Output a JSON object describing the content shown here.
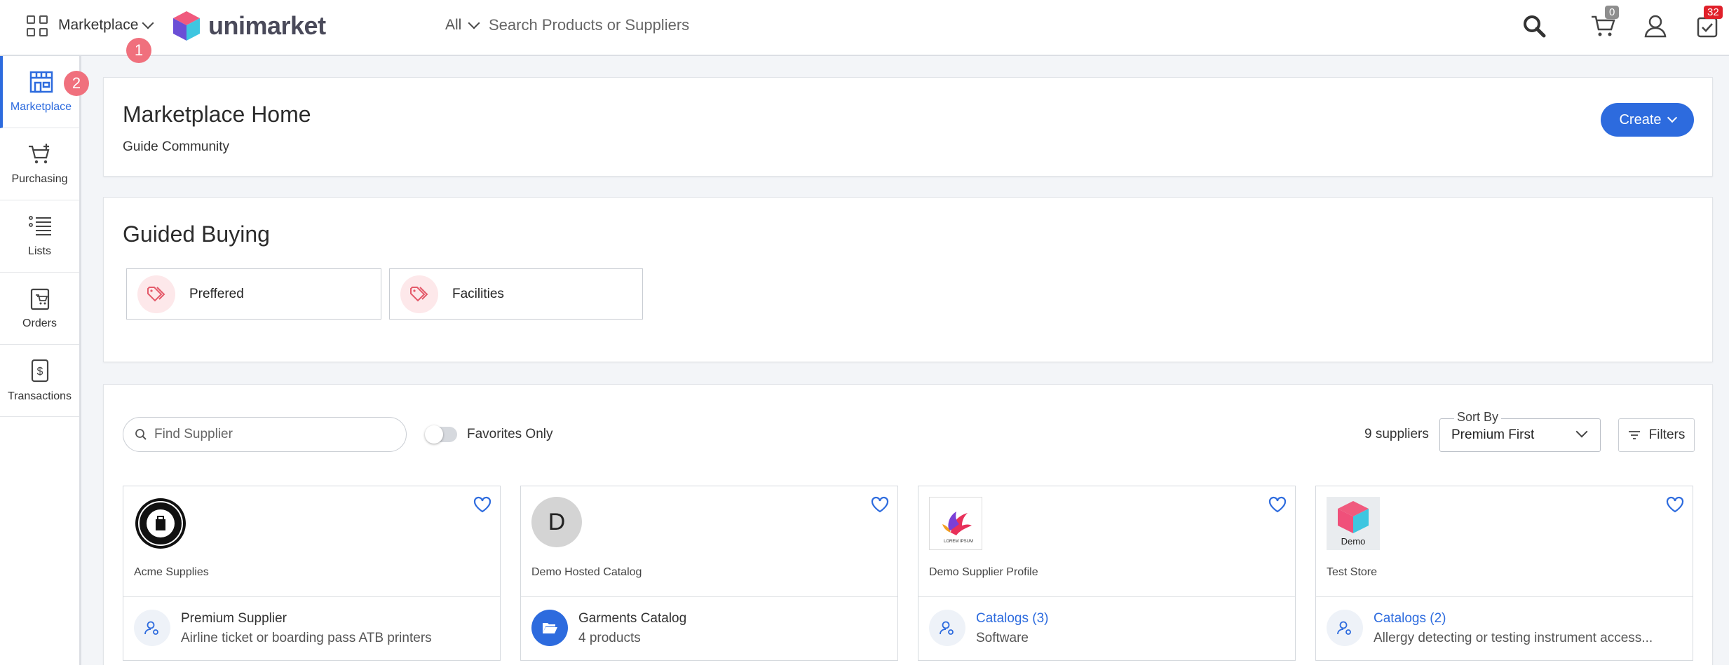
{
  "header": {
    "app_menu_label": "Marketplace",
    "brand_name": "unimarket",
    "search_scope": "All",
    "search_placeholder": "Search Products or Suppliers",
    "cart_count": "0",
    "tasks_count": "32",
    "step_markers": [
      "1",
      "2"
    ]
  },
  "sidebar": {
    "items": [
      {
        "label": "Marketplace",
        "icon": "store-icon",
        "active": true
      },
      {
        "label": "Purchasing",
        "icon": "cart-add-icon"
      },
      {
        "label": "Lists",
        "icon": "list-icon"
      },
      {
        "label": "Orders",
        "icon": "orders-icon"
      },
      {
        "label": "Transactions",
        "icon": "transactions-icon"
      }
    ]
  },
  "home": {
    "title": "Marketplace Home",
    "subtitle": "Guide Community",
    "create_label": "Create"
  },
  "guided_buying": {
    "title": "Guided Buying",
    "tiles": [
      {
        "label": "Preffered",
        "icon": "tag-icon"
      },
      {
        "label": "Facilities",
        "icon": "tag-icon"
      }
    ]
  },
  "suppliers": {
    "find_placeholder": "Find Supplier",
    "favorites_label": "Favorites Only",
    "count_label": "9 suppliers",
    "sort_legend": "Sort By",
    "sort_value": "Premium First",
    "filters_label": "Filters",
    "cards": [
      {
        "name": "Acme Supplies",
        "line1": "Premium Supplier",
        "line2": "Airline ticket or boarding pass ATB printers",
        "line1_link": false
      },
      {
        "name": "Demo Hosted Catalog",
        "logo_letter": "D",
        "line1": "Garments Catalog",
        "line2": "4 products",
        "line1_link": false
      },
      {
        "name": "Demo Supplier Profile",
        "line1": "Catalogs (3)",
        "line2": "Software",
        "line1_link": true
      },
      {
        "name": "Test Store",
        "logo_text": "Demo",
        "line1": "Catalogs (2)",
        "line2": "Allergy detecting or testing instrument access...",
        "line1_link": true
      }
    ]
  },
  "colors": {
    "accent": "#2d6bde",
    "marker": "#f0707d",
    "alert": "#e0202a"
  }
}
